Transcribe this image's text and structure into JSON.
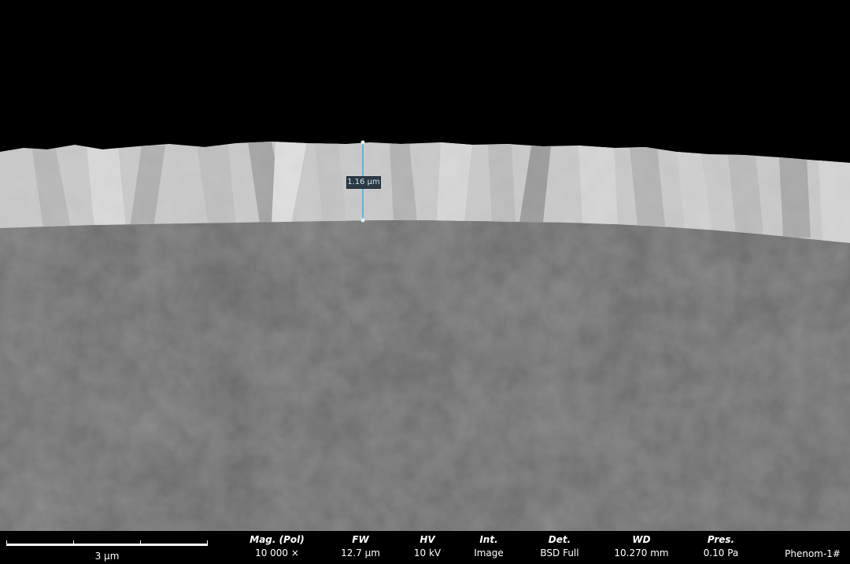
{
  "measurement": {
    "value": "1.16 µm"
  },
  "scale_bar": {
    "label": "3 µm"
  },
  "info_fields": [
    {
      "title": "Mag. (Pol)",
      "value": "10 000 ×"
    },
    {
      "title": "FW",
      "value": "12.7 µm"
    },
    {
      "title": "HV",
      "value": "10 kV"
    },
    {
      "title": "Int.",
      "value": "Image"
    },
    {
      "title": "Det.",
      "value": "BSD Full"
    },
    {
      "title": "WD",
      "value": "10.270 mm"
    },
    {
      "title": "Pres.",
      "value": "0.10 Pa"
    }
  ],
  "brand": "Phenom-1#",
  "colors": {
    "measure_line": "#4aa6e0",
    "coating": "#d2d2d2",
    "substrate": "#4a4a4a",
    "background": "#000000"
  }
}
